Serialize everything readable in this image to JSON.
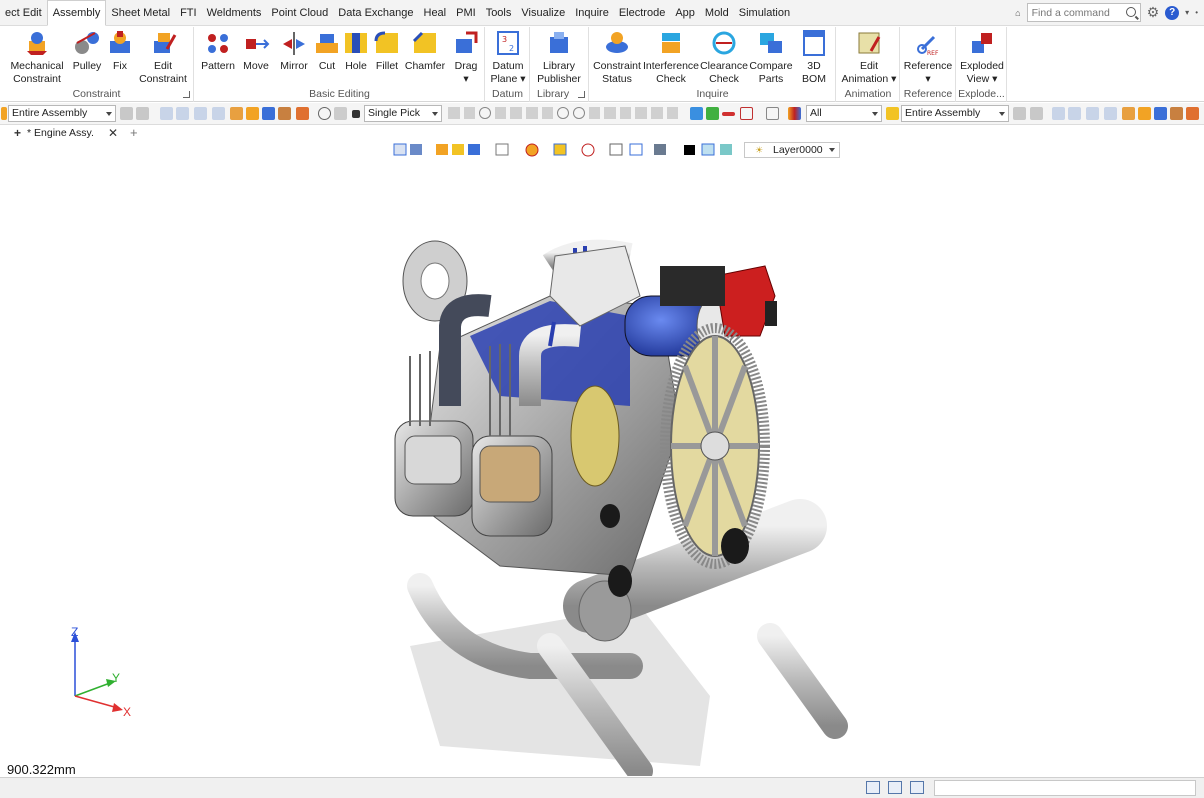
{
  "menubar": {
    "items": [
      "ect Edit",
      "Assembly",
      "Sheet Metal",
      "FTI",
      "Weldments",
      "Point Cloud",
      "Data Exchange",
      "Heal",
      "PMI",
      "Tools",
      "Visualize",
      "Inquire",
      "Electrode",
      "App",
      "Mold",
      "Simulation"
    ],
    "active_index": 1,
    "search_placeholder": "Find a command"
  },
  "ribbon": {
    "groups": [
      {
        "label": "Constraint",
        "buttons": [
          [
            "Mechanical",
            "Constraint"
          ],
          [
            "Pulley",
            ""
          ],
          [
            "Fix",
            ""
          ],
          [
            "Edit",
            "Constraint"
          ]
        ]
      },
      {
        "label": "Basic Editing",
        "buttons": [
          [
            "Pattern",
            ""
          ],
          [
            "Move",
            ""
          ],
          [
            "Mirror",
            ""
          ],
          [
            "Cut",
            ""
          ],
          [
            "Hole",
            ""
          ],
          [
            "Fillet",
            ""
          ],
          [
            "Chamfer",
            ""
          ],
          [
            "Drag",
            "▾"
          ]
        ]
      },
      {
        "label": "Datum",
        "buttons": [
          [
            "Datum",
            "Plane ▾"
          ]
        ]
      },
      {
        "label": "Library",
        "buttons": [
          [
            "Library",
            "Publisher"
          ]
        ]
      },
      {
        "label": "Inquire",
        "buttons": [
          [
            "Constraint",
            "Status"
          ],
          [
            "Interference",
            "Check"
          ],
          [
            "Clearance",
            "Check"
          ],
          [
            "Compare",
            "Parts"
          ],
          [
            "3D BOM",
            ""
          ]
        ]
      },
      {
        "label": "Animation",
        "buttons": [
          [
            "Edit",
            "Animation ▾"
          ]
        ]
      },
      {
        "label": "Reference",
        "buttons": [
          [
            "Reference",
            "▾"
          ]
        ]
      },
      {
        "label": "Explode...",
        "buttons": [
          [
            "Exploded",
            "View ▾"
          ]
        ]
      }
    ]
  },
  "toolbar": {
    "scope_left": "Entire Assembly",
    "pick_mode": "Single Pick",
    "filter": "All",
    "scope_right": "Entire Assembly"
  },
  "document": {
    "tab_label": "* Engine Assy."
  },
  "view": {
    "layer": "Layer0000",
    "scale": "900.322mm",
    "axis_x": "X",
    "axis_y": "Y",
    "axis_z": "Z"
  },
  "colors": {
    "accent_blue": "#2a4fb8",
    "engine_red": "#cc1f1f",
    "engine_gray": "#b9b9b9",
    "flywheel_yellow": "#e3d9a0"
  }
}
